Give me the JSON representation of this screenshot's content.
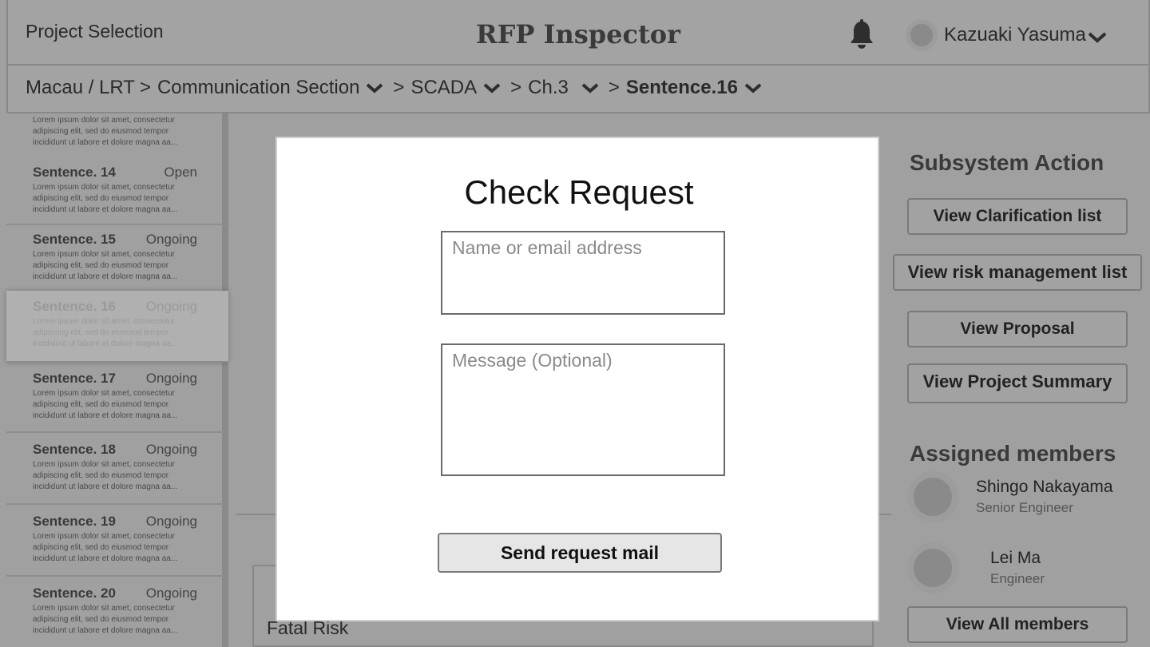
{
  "header": {
    "project_selection": "Project Selection",
    "app_title": "RFP Inspector",
    "user_name": "Kazuaki Yasuma"
  },
  "breadcrumb": {
    "root": "Macau / LRT",
    "section": "Communication Section",
    "subsystem": "SCADA",
    "chapter": "Ch.3",
    "sentence": "Sentence.16",
    "separator": ">"
  },
  "sidebar": {
    "lorem": "Lorem ipsum dolor sit amet, consectetur adipiscing elit, sed do eiusmod tempor incididunt ut labore et dolore magna aa...",
    "items": [
      {
        "title": "Sentence. 14",
        "status": "Open"
      },
      {
        "title": "Sentence. 15",
        "status": "Ongoing"
      },
      {
        "title": "Sentence. 16",
        "status": "Ongoing"
      },
      {
        "title": "Sentence. 17",
        "status": "Ongoing"
      },
      {
        "title": "Sentence. 18",
        "status": "Ongoing"
      },
      {
        "title": "Sentence. 19",
        "status": "Ongoing"
      },
      {
        "title": "Sentence. 20",
        "status": "Ongoing"
      }
    ]
  },
  "background": {
    "fatal_risk": "Fatal Risk"
  },
  "right_panel": {
    "subsystem_action_heading": "Subsystem Action",
    "buttons": {
      "clarification": "View Clarification list",
      "risk": "View risk management list",
      "proposal": "View Proposal",
      "summary": "View Project Summary"
    },
    "assigned_heading": "Assigned members",
    "members": [
      {
        "name": "Shingo Nakayama",
        "role": "Senior Engineer"
      },
      {
        "name": "Lei Ma",
        "role": "Engineer"
      }
    ],
    "view_all": "View All members"
  },
  "modal": {
    "title": "Check Request",
    "name_placeholder": "Name or email address",
    "message_placeholder": "Message (Optional)",
    "send_label": "Send request mail"
  }
}
